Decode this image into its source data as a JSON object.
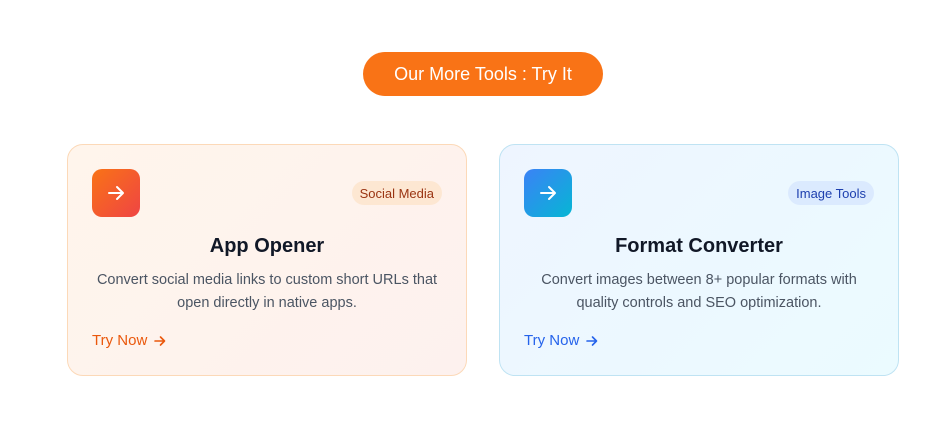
{
  "header": {
    "label": "Our More Tools : Try It"
  },
  "cards": [
    {
      "icon": "arrow-right-icon",
      "badge": "Social Media",
      "title": "App Opener",
      "description": "Convert social media links to custom short URLs that open directly in native apps.",
      "cta": "Try Now",
      "accent": "#f97316"
    },
    {
      "icon": "arrow-right-icon",
      "badge": "Image Tools",
      "title": "Format Converter",
      "description": "Convert images between 8+ popular formats with quality controls and SEO optimization.",
      "cta": "Try Now",
      "accent": "#3b82f6"
    }
  ]
}
